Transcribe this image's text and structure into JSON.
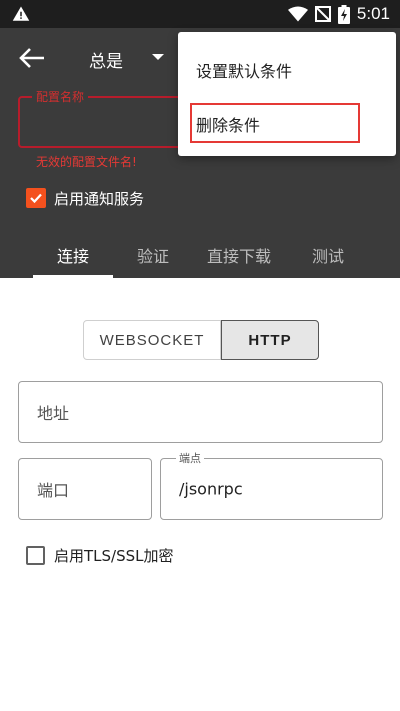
{
  "status_bar": {
    "time": "5:01",
    "icons": [
      "warning-icon",
      "wifi-icon",
      "no-sim-icon",
      "battery-charging-icon"
    ]
  },
  "toolbar": {
    "back_icon": "arrow-left-icon",
    "spinner_value": "总是",
    "profile_name_label": "配置名称",
    "profile_name_value": "",
    "profile_name_error": "无效的配置文件名!",
    "notify_label": "启用通知服务",
    "notify_checked": true
  },
  "tabs": [
    {
      "label": "连接",
      "active": true
    },
    {
      "label": "验证",
      "active": false
    },
    {
      "label": "直接下载",
      "active": false
    },
    {
      "label": "测试",
      "active": false
    }
  ],
  "connection": {
    "modes": [
      "WEBSOCKET",
      "HTTP"
    ],
    "selected_mode": "HTTP",
    "address_placeholder": "地址",
    "port_placeholder": "端口",
    "endpoint_label": "端点",
    "endpoint_value": "/jsonrpc",
    "tls_label": "启用TLS/SSL加密",
    "tls_checked": false
  },
  "overflow_menu": {
    "items": [
      "设置默认条件",
      "删除条件"
    ]
  },
  "colors": {
    "toolbar_bg": "#3b3b3b",
    "accent": "#f4511e",
    "error": "#e53935"
  }
}
